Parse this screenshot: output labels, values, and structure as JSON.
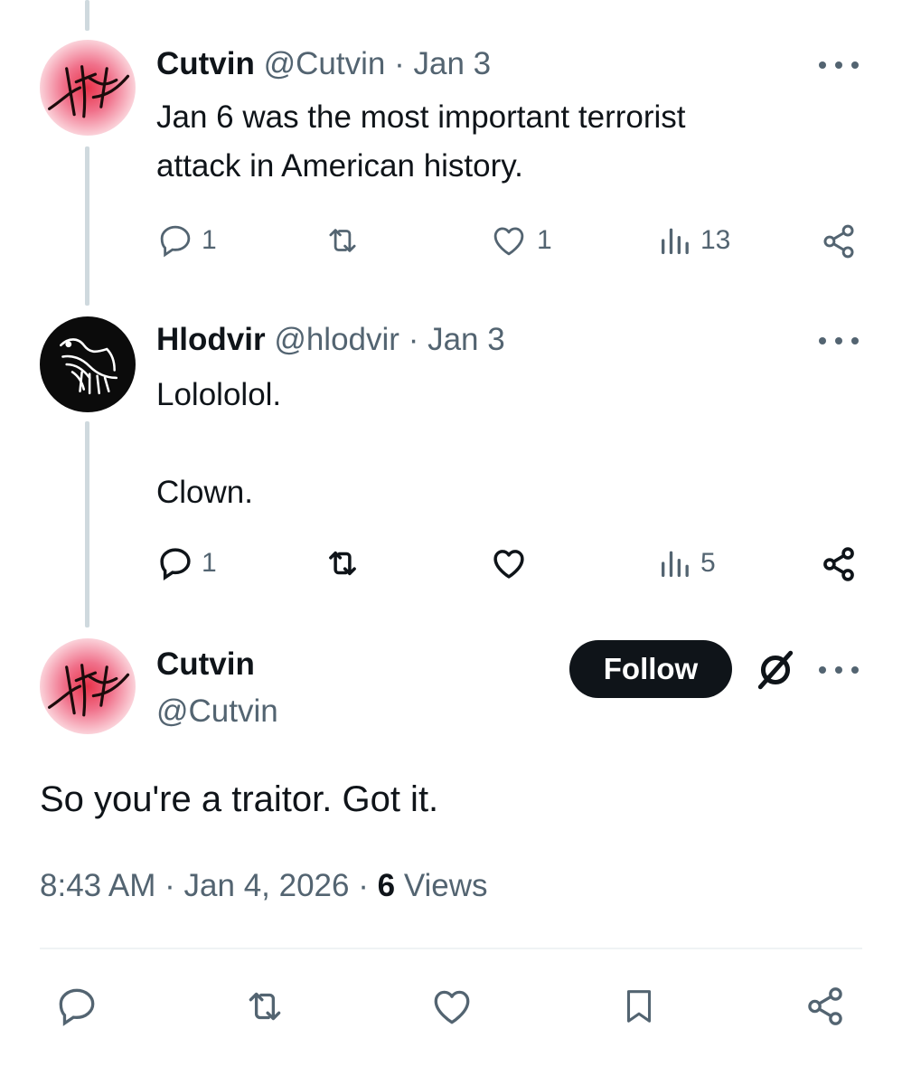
{
  "tweets": [
    {
      "display_name": "Cutvin",
      "handle": "@Cutvin",
      "separator": "·",
      "date": "Jan 3",
      "text": "Jan 6 was the most important terrorist\nattack in American history.",
      "avatar_icon": "red-glyph-avatar",
      "actions": {
        "reply_count": "1",
        "repost_count": "",
        "like_count": "1",
        "view_count": "13"
      }
    },
    {
      "display_name": "Hlodvir",
      "handle": "@hlodvir",
      "separator": "·",
      "date": "Jan 3",
      "text": "Lolololol.\n\nClown.",
      "avatar_icon": "raven-banner-avatar",
      "actions": {
        "reply_count": "1",
        "repost_count": "",
        "like_count": "",
        "view_count": "5"
      }
    }
  ],
  "main_tweet": {
    "display_name": "Cutvin",
    "handle": "@Cutvin",
    "follow_label": "Follow",
    "text": "So you're a traitor. Got it.",
    "time": "8:43 AM",
    "sep1": "·",
    "date": "Jan 4, 2026",
    "sep2": "·",
    "views_count": "6",
    "views_label": "Views",
    "avatar_icon": "red-glyph-avatar"
  },
  "icons": {
    "reply": "reply-icon",
    "repost": "repost-icon",
    "like": "heart-icon",
    "views": "bar-chart-icon",
    "share": "share-icon",
    "bookmark": "bookmark-icon",
    "more": "more-icon",
    "grok": "grok-icon"
  },
  "colors": {
    "text": "#0f1419",
    "muted": "#536471",
    "thread_line": "#cfd9de",
    "follow_bg": "#0f1419",
    "avatar_red": "#e8334a"
  }
}
